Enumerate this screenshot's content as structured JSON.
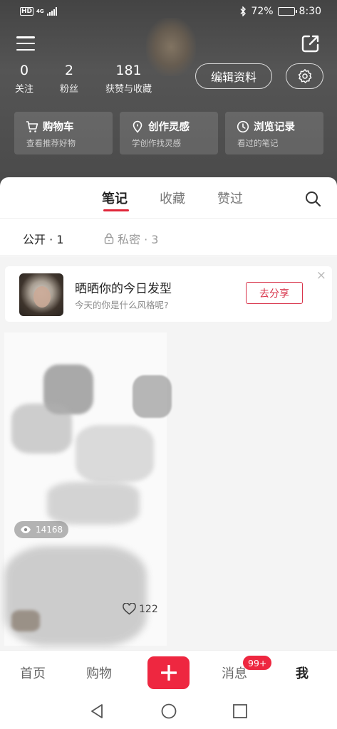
{
  "status_bar": {
    "hd": "HD",
    "network": "4G",
    "battery": "72%",
    "battery_level": 0.72,
    "time": "8:30"
  },
  "profile": {
    "stats": [
      {
        "value": "0",
        "label": "关注"
      },
      {
        "value": "2",
        "label": "粉丝"
      },
      {
        "value": "181",
        "label": "获赞与收藏"
      }
    ],
    "edit_label": "编辑资料"
  },
  "quick_cards": [
    {
      "title": "购物车",
      "subtitle": "查看推荐好物",
      "icon": "cart-icon"
    },
    {
      "title": "创作灵感",
      "subtitle": "学创作找灵感",
      "icon": "location-pin-icon"
    },
    {
      "title": "浏览记录",
      "subtitle": "看过的笔记",
      "icon": "clock-icon"
    }
  ],
  "tabs": [
    {
      "label": "笔记",
      "active": true
    },
    {
      "label": "收藏",
      "active": false
    },
    {
      "label": "赞过",
      "active": false
    }
  ],
  "filters": {
    "public": "公开 · 1",
    "private": "私密 · 3"
  },
  "promo": {
    "title": "晒晒你的今日发型",
    "subtitle": "今天的你是什么风格呢?",
    "button": "去分享",
    "close": "×"
  },
  "note": {
    "views": "14168",
    "likes": "122"
  },
  "bottom_nav": {
    "items": [
      "首页",
      "购物",
      "消息",
      "我"
    ],
    "badge": "99+",
    "plus": "+"
  },
  "colors": {
    "accent": "#ee2740",
    "header_bg": "#4d4d4d"
  }
}
